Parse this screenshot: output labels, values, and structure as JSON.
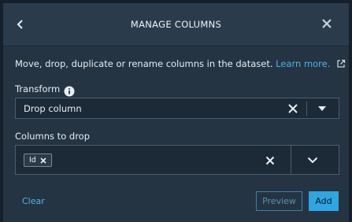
{
  "header": {
    "title": "MANAGE COLUMNS",
    "back_icon": "chevron-left-icon",
    "close_icon": "close-icon"
  },
  "description": {
    "text": "Move, drop, duplicate or rename columns in the dataset.",
    "link_text": "Learn more.",
    "link_icon": "external-link-icon"
  },
  "transform": {
    "label": "Transform",
    "info_icon": "info-icon",
    "value": "Drop column"
  },
  "columns_to_drop": {
    "label": "Columns to drop",
    "chips": [
      "Id"
    ]
  },
  "footer": {
    "clear_label": "Clear",
    "preview_label": "Preview",
    "add_label": "Add"
  },
  "colors": {
    "accent": "#2da6e2",
    "link": "#4cb5e8",
    "panel_bg": "#243443"
  }
}
